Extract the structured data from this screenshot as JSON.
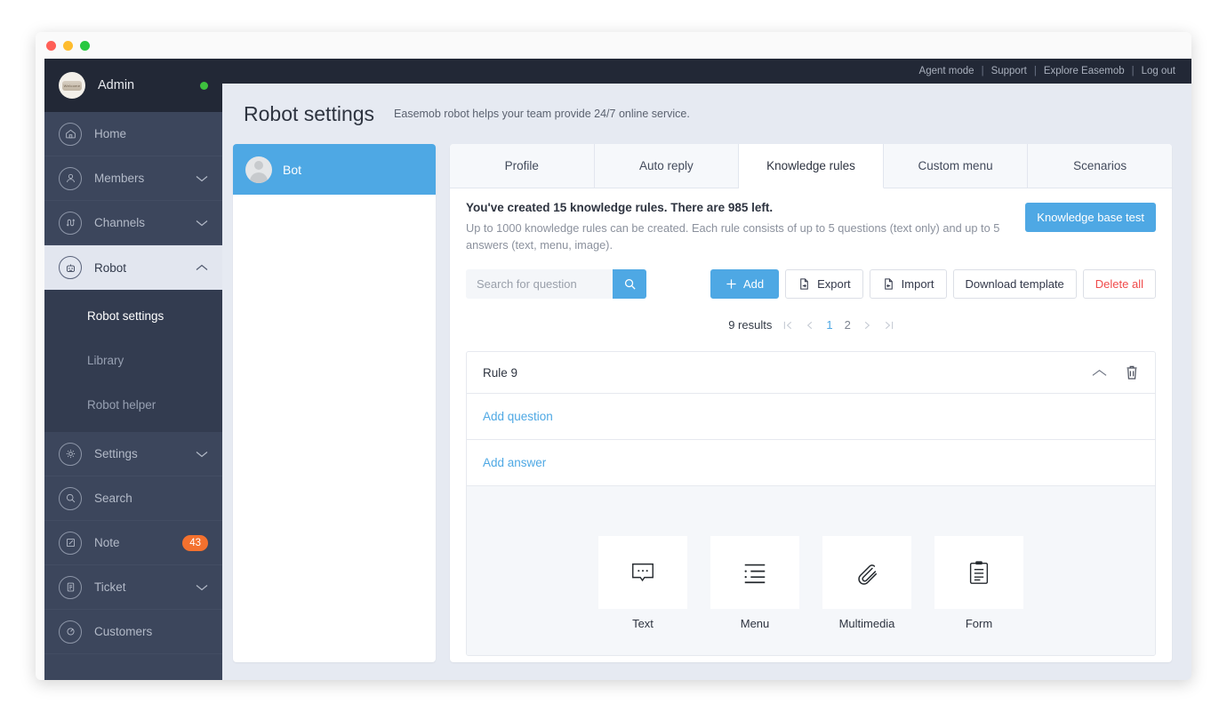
{
  "window": {
    "traffic_lights": [
      "close",
      "minimize",
      "maximize"
    ]
  },
  "sidebar": {
    "profile": {
      "name": "Admin",
      "status": "online",
      "status_color": "#3ec13e",
      "avatar_icon": "user-avatar"
    },
    "items": [
      {
        "label": "Home",
        "icon": "home-icon",
        "expandable": false,
        "active": false
      },
      {
        "label": "Members",
        "icon": "members-icon",
        "expandable": true,
        "active": false
      },
      {
        "label": "Channels",
        "icon": "channels-icon",
        "expandable": true,
        "active": false
      },
      {
        "label": "Robot",
        "icon": "robot-icon",
        "expandable": true,
        "active": true,
        "expanded": true
      },
      {
        "label": "Settings",
        "icon": "gear-icon",
        "expandable": true,
        "active": false
      },
      {
        "label": "Search",
        "icon": "search-icon",
        "expandable": false,
        "active": false
      },
      {
        "label": "Note",
        "icon": "note-icon",
        "expandable": false,
        "active": false,
        "badge": "43"
      },
      {
        "label": "Ticket",
        "icon": "ticket-icon",
        "expandable": true,
        "active": false
      },
      {
        "label": "Customers",
        "icon": "customers-icon",
        "expandable": false,
        "active": false
      }
    ],
    "submenu": [
      {
        "label": "Robot settings",
        "current": true
      },
      {
        "label": "Library",
        "current": false
      },
      {
        "label": "Robot helper",
        "current": false
      }
    ]
  },
  "topbar": {
    "links": [
      "Agent mode",
      "Support",
      "Explore Easemob",
      "Log out"
    ],
    "separator": "|"
  },
  "header": {
    "title": "Robot settings",
    "subtitle": "Easemob robot helps your team provide 24/7 online service."
  },
  "bot_panel": {
    "items": [
      {
        "name": "Bot",
        "selected": true,
        "avatar_icon": "user-avatar"
      }
    ]
  },
  "tabs": [
    {
      "label": "Profile",
      "active": false
    },
    {
      "label": "Auto reply",
      "active": false
    },
    {
      "label": "Knowledge rules",
      "active": true
    },
    {
      "label": "Custom menu",
      "active": false
    },
    {
      "label": "Scenarios",
      "active": false
    }
  ],
  "info": {
    "line1": "You've created 15 knowledge rules. There are 985 left.",
    "line2": "Up to 1000 knowledge rules can be created. Each rule consists of up to 5 questions (text only) and up to 5 answers (text, menu, image).",
    "kb_test_label": "Knowledge base test",
    "created_count": 15,
    "remaining_count": 985,
    "max_rules": 1000
  },
  "toolbar": {
    "search_placeholder": "Search for question",
    "search_value": "",
    "search_icon": "search-icon",
    "add_label": "Add",
    "export_label": "Export",
    "import_label": "Import",
    "download_template_label": "Download template",
    "delete_all_label": "Delete all"
  },
  "pagination": {
    "results_label": "9 results",
    "results_count": 9,
    "first": "|<",
    "prev": "<",
    "pages": [
      {
        "label": "1",
        "active": true
      },
      {
        "label": "2",
        "active": false
      }
    ],
    "next": ">",
    "last": ">|"
  },
  "rule": {
    "title": "Rule 9",
    "collapse_icon": "chevron-up-icon",
    "delete_icon": "trash-icon",
    "add_question_label": "Add question",
    "add_answer_label": "Add answer",
    "answer_types": [
      {
        "label": "Text",
        "icon": "speech-bubble-icon"
      },
      {
        "label": "Menu",
        "icon": "list-icon"
      },
      {
        "label": "Multimedia",
        "icon": "paperclip-icon"
      },
      {
        "label": "Form",
        "icon": "clipboard-icon"
      }
    ]
  },
  "colors": {
    "accent": "#4ea8e4",
    "sidebar": "#3c465c",
    "sidebar_dark": "#222836",
    "page_bg": "#e6eaf2",
    "danger": "#f04a4a",
    "badge": "#f4712e",
    "online": "#3ec13e"
  }
}
